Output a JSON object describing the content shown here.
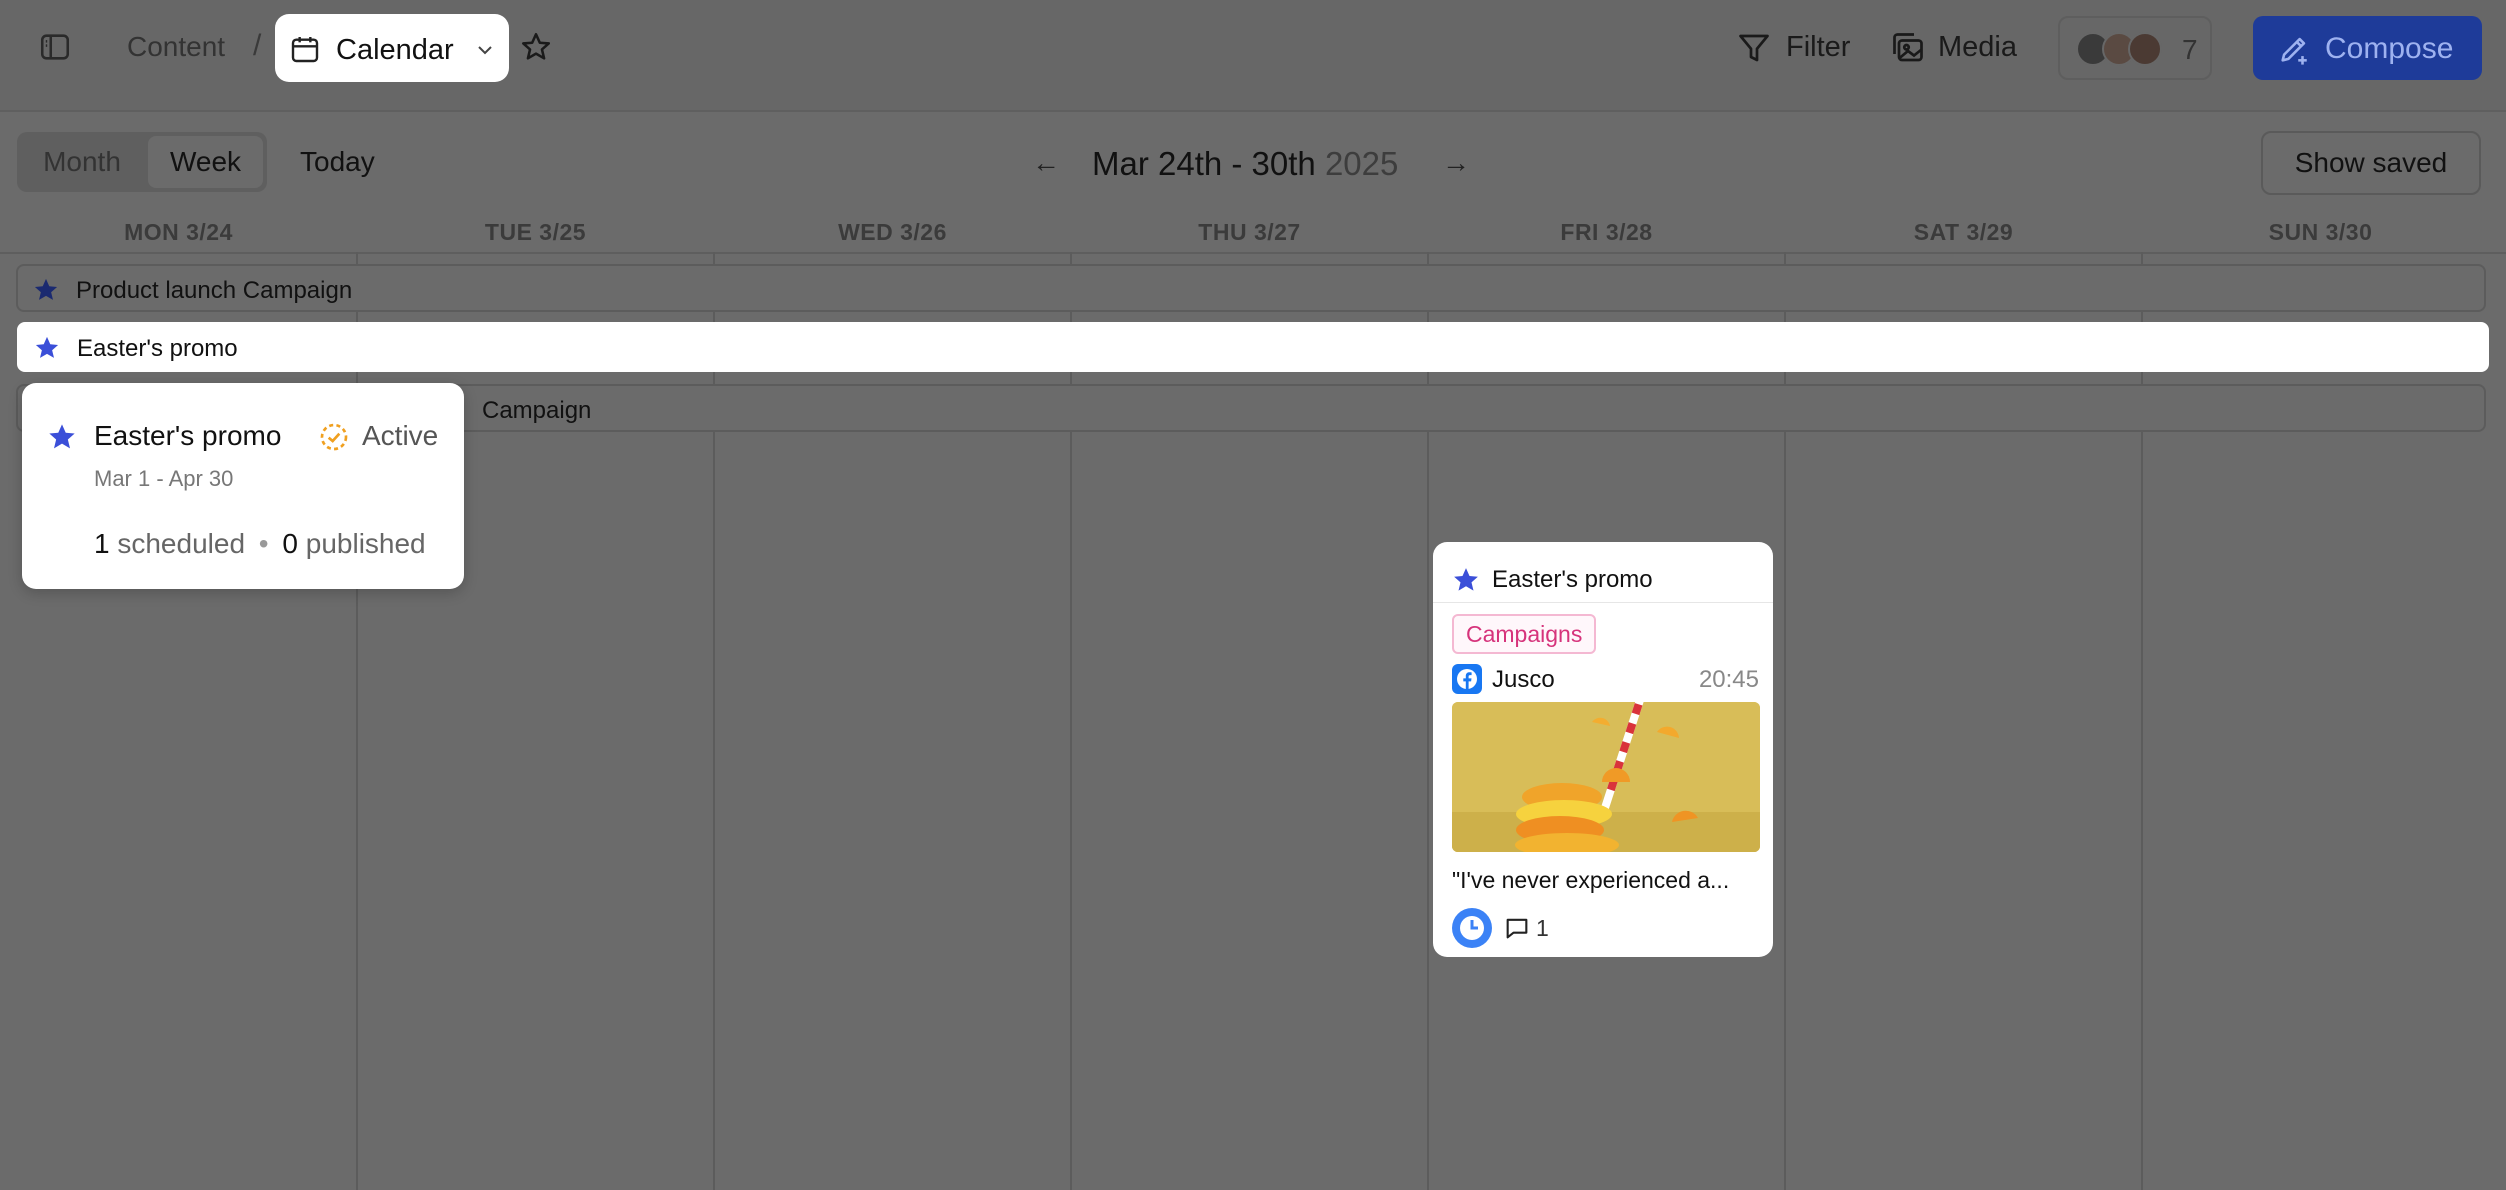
{
  "topbar": {
    "breadcrumb_root": "Content",
    "breadcrumb_sep": "/",
    "current_view": "Calendar",
    "filter_label": "Filter",
    "media_label": "Media",
    "collaborator_count": "7",
    "compose_label": "Compose"
  },
  "calendar": {
    "view_month": "Month",
    "view_week": "Week",
    "today_label": "Today",
    "prev_arrow": "←",
    "next_arrow": "→",
    "range": "Mar 24th - 30th",
    "year": "2025",
    "show_saved_label": "Show saved",
    "days": [
      "MON 3/24",
      "TUE 3/25",
      "WED 3/26",
      "THU 3/27",
      "FRI 3/28",
      "SAT 3/29",
      "SUN 3/30"
    ]
  },
  "campaigns": [
    {
      "label": "Product launch Campaign"
    },
    {
      "label": "Easter's promo"
    },
    {
      "label": "Campaign"
    }
  ],
  "popover": {
    "title": "Easter's promo",
    "status": "Active",
    "dates": "Mar 1 - Apr 30",
    "scheduled_count": "1",
    "scheduled_label": "scheduled",
    "dot": "•",
    "published_count": "0",
    "published_label": "published"
  },
  "post": {
    "campaign": "Easter's promo",
    "tag": "Campaigns",
    "account": "Jusco",
    "time": "20:45",
    "caption": "\"I've never experienced a...",
    "comments": "1"
  },
  "colors": {
    "accent_blue": "#1e3b99",
    "star_blue": "#3b4fd8",
    "tag_pink": "#d6337b",
    "facebook": "#1877f2",
    "status_orange": "#f0a020"
  }
}
